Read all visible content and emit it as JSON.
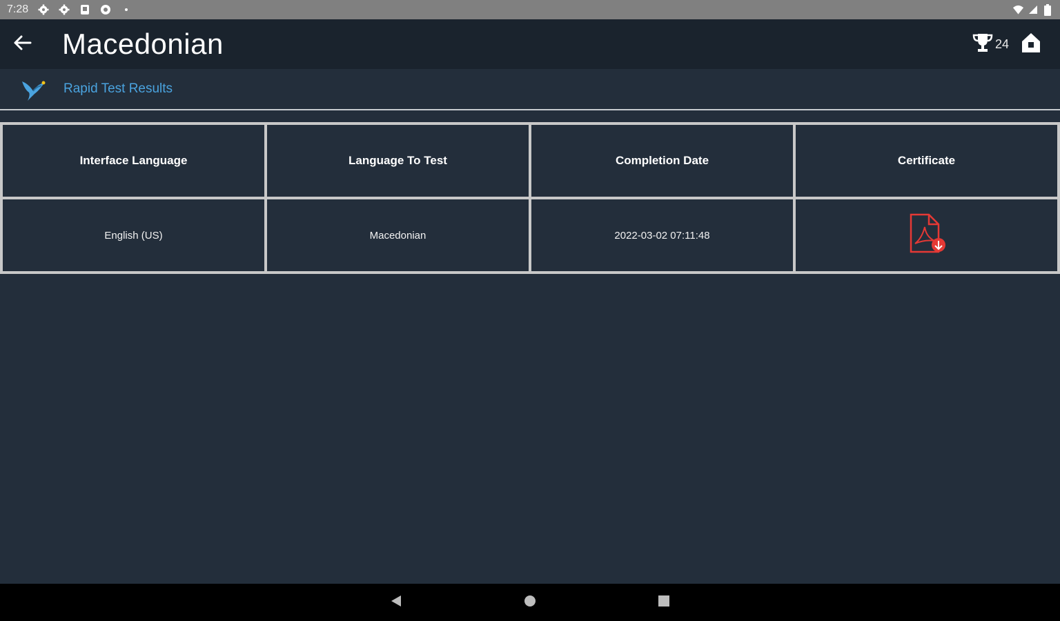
{
  "status_bar": {
    "time": "7:28",
    "icons": [
      "gear-icon",
      "gear-icon",
      "sd-card-icon",
      "shield-icon",
      "dot-icon"
    ],
    "right_icons": [
      "wifi-icon",
      "signal-icon",
      "battery-icon"
    ]
  },
  "app_bar": {
    "title": "Macedonian",
    "trophy_count": "24",
    "icons": [
      "back-arrow-icon",
      "trophy-icon",
      "home-icon"
    ]
  },
  "sub_header": {
    "title": "Rapid Test Results",
    "logo_icon": "bird-logo-icon"
  },
  "results": {
    "columns": [
      "Interface Language",
      "Language To Test",
      "Completion Date",
      "Certificate"
    ],
    "rows": [
      {
        "interface_language": "English (US)",
        "language_to_test": "Macedonian",
        "completion_date": "2022-03-02 07:11:48",
        "certificate_icon": "pdf-download-icon"
      }
    ]
  },
  "colors": {
    "background": "#232e3b",
    "app_bar": "#1a232d",
    "accent_link": "#4aa3df",
    "pdf_red": "#e53935"
  },
  "nav_bar": {
    "icons": [
      "nav-back-icon",
      "nav-home-icon",
      "nav-recents-icon"
    ]
  }
}
